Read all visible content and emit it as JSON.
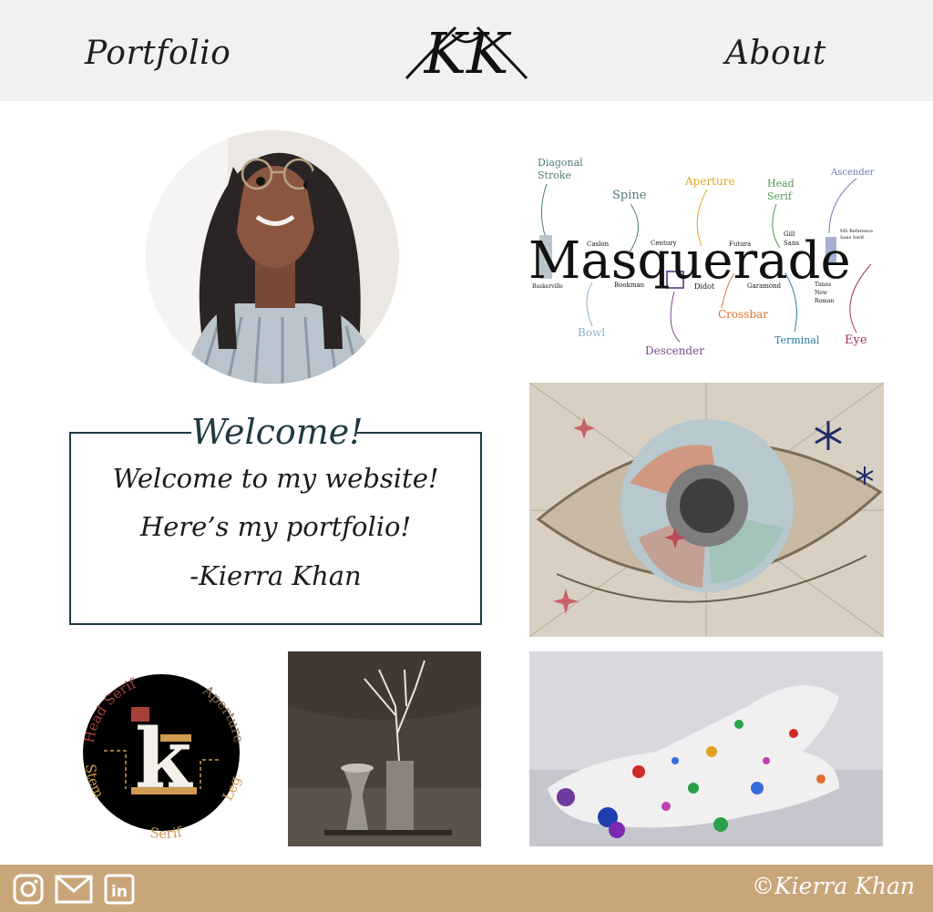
{
  "header": {
    "nav_left": "Portfolio",
    "nav_right": "About",
    "logo_text": "KK"
  },
  "welcome": {
    "title": "Welcome!",
    "line1": "Welcome to my website!",
    "line2": "Here’s my portfolio!",
    "line3": "-Kierra Khan"
  },
  "masquerade": {
    "word": "Masquerade",
    "labels": {
      "diagonal_stroke_1": "Diagonal",
      "diagonal_stroke_2": "Stroke",
      "spine": "Spine",
      "aperture": "Aperture",
      "head_serif_1": "Head",
      "head_serif_2": "Serif",
      "ascender": "Ascender",
      "bowl": "Bowl",
      "descender": "Descender",
      "crossbar": "Crossbar",
      "terminal": "Terminal",
      "eye": "Eye"
    },
    "fonts": {
      "caslon": "Caslon",
      "century": "Century",
      "futura": "Futura",
      "gill_1": "Gill",
      "gill_2": "Sans",
      "ms_ref_1": "MS Reference",
      "ms_ref_2": "Sans Serif",
      "baskerville": "Baskerville",
      "bookman": "Bookman",
      "didot": "Didot",
      "garamond": "Garamond",
      "times_1": "Times",
      "times_2": "New",
      "times_3": "Roman"
    }
  },
  "k_logo": {
    "letter": "k",
    "head_serif": "Head Serif",
    "aperture": "Aperture",
    "stem": "Stem",
    "serif": "Serif",
    "leg": "Leg"
  },
  "footer": {
    "copyright": "©Kierra Khan",
    "icons": [
      "instagram-icon",
      "mail-icon",
      "linkedin-icon"
    ],
    "background": "#c9a67a"
  },
  "colors": {
    "header_bg": "#f2f1f0",
    "accent_dark": "#1f3a44",
    "footer_bg": "#c9a67a"
  }
}
